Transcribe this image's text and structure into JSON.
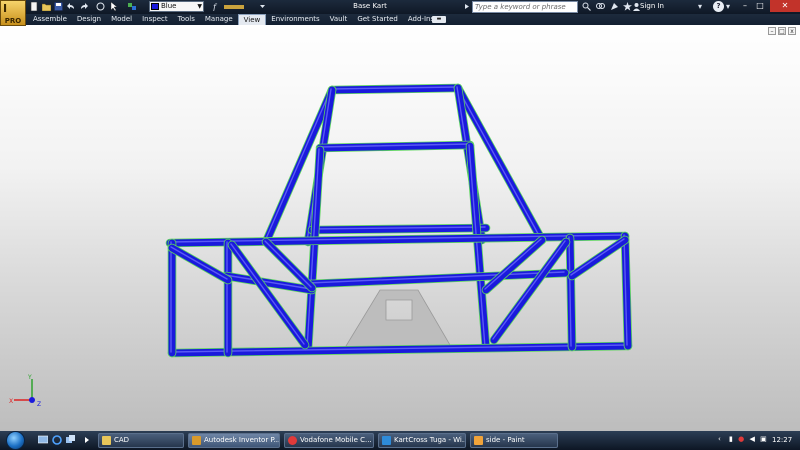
{
  "app": {
    "logo_label": "PRO",
    "doc_title": "Base Kart",
    "color_override": "Blue",
    "search_placeholder": "Type a keyword or phrase",
    "sign_in": "Sign In"
  },
  "ribbon": {
    "tabs": [
      "Assemble",
      "Design",
      "Model",
      "Inspect",
      "Tools",
      "Manage",
      "View",
      "Environments",
      "Vault",
      "Get Started",
      "Add-Ins"
    ],
    "active_tab": "View"
  },
  "viewport": {
    "frame_color": "#1a1adc",
    "edge_highlight_color": "#5cd65c",
    "plate_color": "#bdbdbd",
    "triad": {
      "x": "X",
      "y": "Y",
      "z": "Z"
    }
  },
  "taskbar": {
    "tasks": [
      {
        "label": "CAD",
        "icon": "folder-icon"
      },
      {
        "label": "Autodesk Inventor P...",
        "icon": "inventor-icon",
        "active": true
      },
      {
        "label": "Vodafone Mobile C...",
        "icon": "vodafone-icon"
      },
      {
        "label": "KartCross Tuga - Wi...",
        "icon": "browser-icon"
      },
      {
        "label": "side - Paint",
        "icon": "paint-icon"
      }
    ],
    "clock": "12:27"
  },
  "icons": {
    "new": "new-file-icon",
    "open": "open-folder-icon",
    "save": "save-icon",
    "undo": "undo-icon",
    "redo": "redo-icon",
    "help": "help-icon"
  }
}
